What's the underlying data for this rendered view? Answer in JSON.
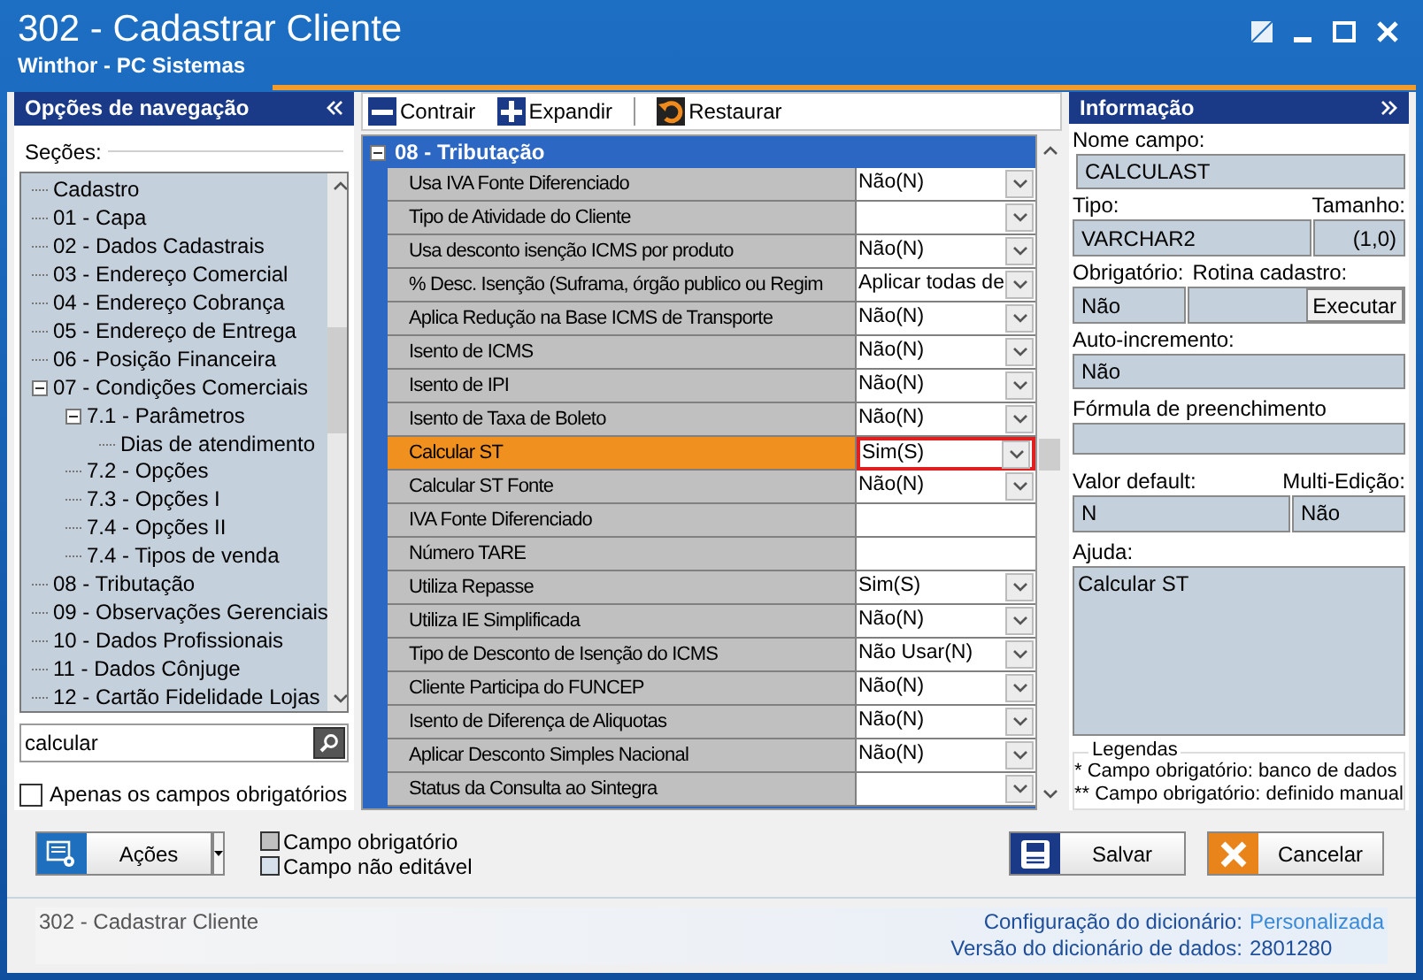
{
  "window": {
    "title": "302 - Cadastrar Cliente",
    "subtitle": "Winthor - PC Sistemas"
  },
  "navigation": {
    "title": "Opções de navegação",
    "group_label": "Seções:",
    "tree": [
      {
        "label": "Cadastro"
      },
      {
        "label": "01 - Capa"
      },
      {
        "label": "02 - Dados Cadastrais"
      },
      {
        "label": "03 - Endereço Comercial"
      },
      {
        "label": "04 - Endereço Cobrança"
      },
      {
        "label": "05 - Endereço de Entrega"
      },
      {
        "label": "06 - Posição Financeira"
      },
      {
        "label": "07 - Condições Comerciais",
        "expanded": true,
        "children": [
          {
            "label": "7.1 - Parâmetros",
            "expanded": true,
            "children": [
              {
                "label": "Dias de atendimento"
              }
            ]
          },
          {
            "label": "7.2 - Opções"
          },
          {
            "label": "7.3 - Opções I"
          },
          {
            "label": "7.4 - Opções II"
          },
          {
            "label": "7.4 - Tipos de venda"
          }
        ]
      },
      {
        "label": "08 - Tributação"
      },
      {
        "label": "09 - Observações Gerenciais"
      },
      {
        "label": "10 - Dados Profissionais"
      },
      {
        "label": "11 - Dados Cônjuge"
      },
      {
        "label": "12 - Cartão Fidelidade Lojas"
      }
    ],
    "search": {
      "value": "calcular"
    },
    "required_only": {
      "label": "Apenas os campos obrigatórios",
      "checked": false
    }
  },
  "toolbar": [
    "Contrair",
    "Expandir",
    "Restaurar"
  ],
  "section": {
    "title": "08 - Tributação",
    "expanded": true,
    "rows": [
      {
        "label": "Usa IVA Fonte Diferenciado",
        "value": "Não(N)",
        "kind": "dropdown",
        "selected": false
      },
      {
        "label": "Tipo de Atividade do Cliente",
        "kind": "dropdown",
        "selected": false
      },
      {
        "label": "Usa desconto isenção ICMS por produto",
        "value": "Não(N)",
        "kind": "dropdown",
        "selected": false
      },
      {
        "label": "% Desc. Isenção (Suframa, órgão publico ou Regim",
        "value": "Aplicar todas de",
        "kind": "dropdown",
        "selected": false
      },
      {
        "label": "Aplica Redução na Base ICMS de Transporte",
        "value": "Não(N)",
        "kind": "dropdown",
        "selected": false
      },
      {
        "label": "Isento de ICMS",
        "value": "Não(N)",
        "kind": "dropdown",
        "selected": false
      },
      {
        "label": "Isento de IPI",
        "value": "Não(N)",
        "kind": "dropdown",
        "selected": false
      },
      {
        "label": "Isento de Taxa de Boleto",
        "value": "Não(N)",
        "kind": "dropdown",
        "selected": false
      },
      {
        "label": "Calcular ST",
        "value": "Sim(S)",
        "kind": "dropdown",
        "selected": true
      },
      {
        "label": "Calcular ST Fonte",
        "value": "Não(N)",
        "kind": "dropdown",
        "selected": false
      },
      {
        "label": "IVA Fonte Diferenciado",
        "kind": "text",
        "selected": false
      },
      {
        "label": "Número TARE",
        "kind": "text",
        "selected": false
      },
      {
        "label": "Utiliza Repasse",
        "value": "Sim(S)",
        "kind": "dropdown",
        "selected": false
      },
      {
        "label": "Utiliza IE Simplificada",
        "value": "Não(N)",
        "kind": "dropdown",
        "selected": false
      },
      {
        "label": "Tipo de Desconto de Isenção do ICMS",
        "value": "Não Usar(N)",
        "kind": "dropdown",
        "selected": false
      },
      {
        "label": "Cliente Participa do FUNCEP",
        "value": "Não(N)",
        "kind": "dropdown",
        "selected": false
      },
      {
        "label": "Isento de Diferença de Aliquotas",
        "value": "Não(N)",
        "kind": "dropdown",
        "selected": false
      },
      {
        "label": "Aplicar Desconto Simples Nacional",
        "value": "Não(N)",
        "kind": "dropdown",
        "selected": false
      },
      {
        "label": "Status da Consulta ao Sintegra",
        "kind": "dropdown",
        "selected": false
      }
    ]
  },
  "info": {
    "title": "Informação",
    "field_name": {
      "label": "Nome campo:",
      "value": "CALCULAST"
    },
    "type": {
      "label": "Tipo:",
      "value": "VARCHAR2"
    },
    "size": {
      "label": "Tamanho:",
      "value": "(1,0)"
    },
    "required": {
      "label": "Obrigatório:",
      "value": "Não"
    },
    "routine": {
      "label": "Rotina cadastro:",
      "button": "Executar"
    },
    "auto_increment": {
      "label": "Auto-incremento:",
      "value": "Não"
    },
    "formula": {
      "label": "Fórmula de preenchimento"
    },
    "default_value": {
      "label": "Valor default:",
      "value": "N"
    },
    "multi_edit": {
      "label": "Multi-Edição:",
      "value": "Não"
    },
    "help": {
      "label": "Ajuda:",
      "value": "Calcular ST"
    },
    "legend": {
      "title": "Legendas",
      "lines": [
        "* Campo obrigatório: banco de dados",
        "** Campo obrigatório: definido manual"
      ]
    }
  },
  "footer": {
    "actions_button": "Ações",
    "legend": [
      {
        "label": "Campo obrigatório",
        "color": "#c0c0c0"
      },
      {
        "label": "Campo não editável",
        "color": "#d6e0ea"
      }
    ],
    "save_button": "Salvar",
    "cancel_button": "Cancelar"
  },
  "status_bar": {
    "routine": "302 - Cadastrar Cliente",
    "dictionary_label": "Configuração do dicionário:",
    "dictionary_value": "Personalizada",
    "version_label": "Versão do dicionário de dados:",
    "version_value": "2801280"
  }
}
